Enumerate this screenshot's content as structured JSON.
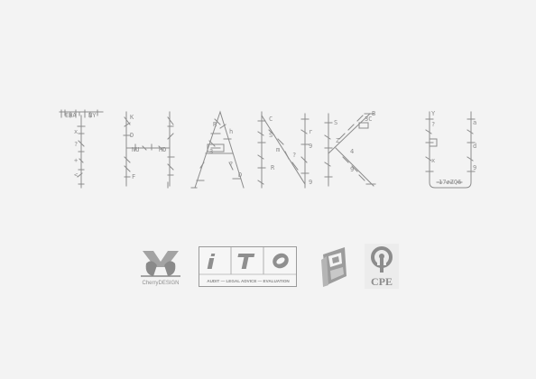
{
  "headline": {
    "text": "THANK U"
  },
  "logos": [
    {
      "name": "cherry-design",
      "text": "CherryDESIGN"
    },
    {
      "name": "ito",
      "letters": [
        "i",
        "T",
        ""
      ],
      "caption": "AUDIT — LEGAL ADVICE — EVALUATION"
    },
    {
      "name": "pr-emblem"
    },
    {
      "name": "cpe",
      "text": "CPE"
    }
  ],
  "colors": {
    "background": "#f3f3f3",
    "ink": "#8c8c8c"
  }
}
